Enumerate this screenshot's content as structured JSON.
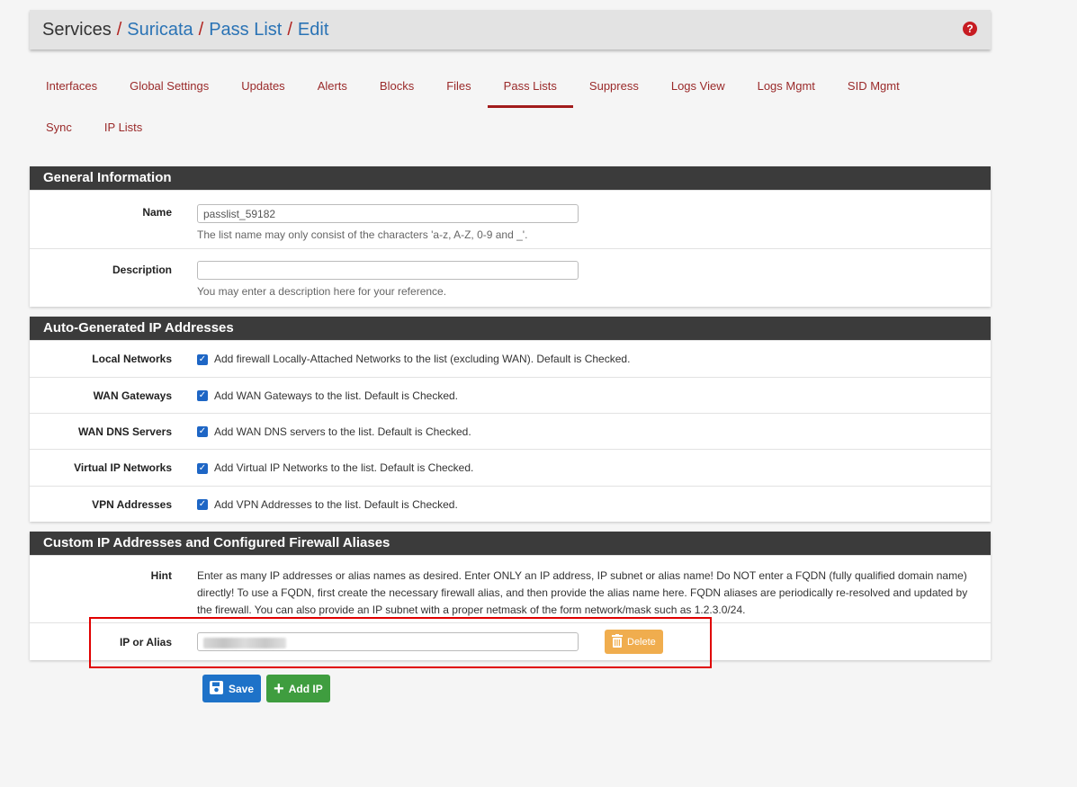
{
  "breadcrumb": {
    "root": "Services",
    "items": [
      "Suricata",
      "Pass List",
      "Edit"
    ],
    "sep": "/"
  },
  "help_icon": "question-circle-icon",
  "tabs": {
    "row1": [
      "Interfaces",
      "Global Settings",
      "Updates",
      "Alerts",
      "Blocks",
      "Files",
      "Pass Lists",
      "Suppress",
      "Logs View",
      "Logs Mgmt",
      "SID Mgmt"
    ],
    "row2": [
      "Sync",
      "IP Lists"
    ],
    "active": "Pass Lists"
  },
  "general": {
    "title": "General Information",
    "name_label": "Name",
    "name_value": "passlist_59182",
    "name_help": "The list name may only consist of the characters 'a-z, A-Z, 0-9 and _'.",
    "desc_label": "Description",
    "desc_value": "",
    "desc_help": "You may enter a description here for your reference."
  },
  "auto": {
    "title": "Auto-Generated IP Addresses",
    "rows": [
      {
        "label": "Local Networks",
        "text": "Add firewall Locally-Attached Networks to the list (excluding WAN). Default is Checked.",
        "checked": true
      },
      {
        "label": "WAN Gateways",
        "text": "Add WAN Gateways to the list. Default is Checked.",
        "checked": true
      },
      {
        "label": "WAN DNS Servers",
        "text": "Add WAN DNS servers to the list. Default is Checked.",
        "checked": true
      },
      {
        "label": "Virtual IP Networks",
        "text": "Add Virtual IP Networks to the list. Default is Checked.",
        "checked": true
      },
      {
        "label": "VPN Addresses",
        "text": "Add VPN Addresses to the list. Default is Checked.",
        "checked": true
      }
    ]
  },
  "custom": {
    "title": "Custom IP Addresses and Configured Firewall Aliases",
    "hint_label": "Hint",
    "hint_text": "Enter as many IP addresses or alias names as desired. Enter ONLY an IP address, IP subnet or alias name! Do NOT enter a FQDN (fully qualified domain name) directly! To use a FQDN, first create the necessary firewall alias, and then provide the alias name here. FQDN aliases are periodically re-resolved and updated by the firewall. You can also provide an IP subnet with a proper netmask of the form network/mask such as 1.2.3.0/24.",
    "ip_label": "IP or Alias",
    "delete_label": "Delete"
  },
  "actions": {
    "save_label": "Save",
    "add_label": "Add IP"
  },
  "colors": {
    "accent_red": "#a21c1c",
    "link_blue": "#2a73b5",
    "panel_header": "#3b3b3b",
    "save": "#1e72c8",
    "add": "#3f9d3f",
    "delete": "#f0ad4e",
    "highlight": "#e00000"
  }
}
